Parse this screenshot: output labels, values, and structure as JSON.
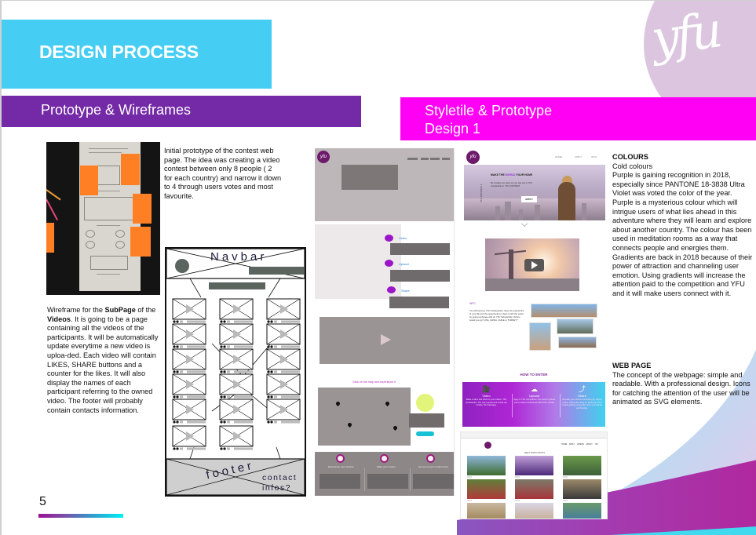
{
  "slide": {
    "title": "DESIGN PROCESS",
    "page_number": "5",
    "logo_text": "yfu"
  },
  "colors": {
    "title_bg": "#45cdf4",
    "section1_bg": "#7429a6",
    "section2_bg": "#ff00f5",
    "logo_circle": "#dcc6df",
    "sticky_note": "#ff7f24"
  },
  "section1": {
    "heading": "Prototype & Wireframes",
    "initial_prototype_text": "Initial prototype of the contest web page. The idea was creating a video contest between only 8 people ( 2 for each country) and narrow it down to 4 through users votes and most favourite.",
    "wireframe_text": {
      "lead": "Wireframe for the ",
      "bold1": "SubPage",
      "mid": " of the ",
      "bold2": "Videos",
      "rest": ". It is going to be a page containing all the videos of the participants. It will be automatically update everytime a new video is uploa-ded. Each video will contain LIKES, SHARE buttons and a counter for the likes. It will also display the names of each participant referring to the owned video. The footer will probably contain contacts information."
    },
    "wireframe": {
      "navbar_label": "Navbar",
      "footer_label": "footer",
      "contact_label_line1": "contact",
      "contact_label_line2": "infos?"
    }
  },
  "section2": {
    "heading_line1": "Styletile & Prototype",
    "heading_line2": "Design 1",
    "mockup1": {
      "logo": "yfu",
      "features": [
        "Video",
        "Upload",
        "Share"
      ],
      "map_caption": "Click on the map and experience it",
      "footer_labels": [
        "Experience new cultures",
        "Make your impact",
        "Get out of your comfort zone"
      ]
    },
    "mockup2": {
      "logo": "yfu",
      "nav": [
        "HOME",
        "APPLY",
        "INFO"
      ],
      "hero_title_pre": "MAKE THE ",
      "hero_title_accent": "WORLD",
      "hero_title_post": " YOUR HOME",
      "hero_sub": "Be creative as show us you can win a YFU scholarship in YFU CONTEST",
      "hero_vertical": "YFU CONTEST 1",
      "apply_button": "APPLY",
      "info_heading": "INFO",
      "info_text": "You will become YFU Ambassador, have the experience of your life and the opportunity to share it with the world by going exchange with an YFU Scholarship. Where would you go? USA, CHINA, CHILE or TURKEY?",
      "how_to_enter": "HOW TO ENTER",
      "steps": [
        {
          "icon": "video-camera-icon",
          "glyph": "🎥",
          "title": "Video",
          "text": "Make a video and show us your culture. YFU ambassador. The only requirement is that you include YFU hashtags."
        },
        {
          "icon": "cloud-upload-icon",
          "glyph": "☁",
          "title": "Upload",
          "text": "Apply to YFU competition. You need to upload you're video on Facebook with #YFU contest"
        },
        {
          "icon": "share-icon",
          "glyph": "⤴",
          "title": "Share",
          "text": "Increase your chances of winning by staying active, sharing the video on facebook #YFU contest getting money likes from your friends and families."
        }
      ]
    },
    "mockup3": {
      "nav": [
        "HOME",
        "APPLY",
        "VIDEOS",
        "ABOUT YFU"
      ],
      "title": "MEET PARTICIPANTS"
    },
    "colours": {
      "heading": "COLOURS",
      "subheading": "Cold colours",
      "text": "Purple is gaining recognition in 2018, especially since PANTONE 18-3838 Ultra Violet was voted the color of the year. Purple is a mysterious colour which will intrigue users of what lies ahead in this adventure where they will learn and explore about another country. The colour has been used in meditation rooms as a way that connects people and energies them. Gradients are back in 2018 because of their power of attraction and channeling user emotion. Using gradients will increase the attention paid to the competition and YFU and it will make users connect with it."
    },
    "webpage": {
      "heading": "WEB PAGE",
      "text": "The concept of the webpage: simple and readable. With a professional design. Icons for catching the attention of the user will be animated as SVG elements."
    }
  }
}
